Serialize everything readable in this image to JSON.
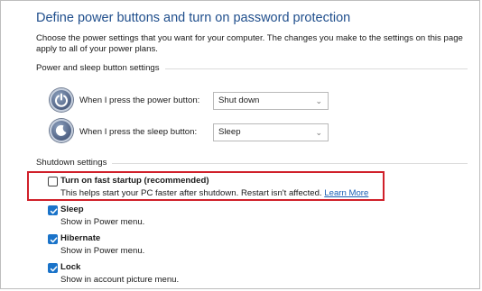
{
  "title": "Define power buttons and turn on password protection",
  "description": "Choose the power settings that you want for your computer. The changes you make to the settings on this page apply to all of your power plans.",
  "power_sleep_group": {
    "label": "Power and sleep button settings",
    "power_button": {
      "label": "When I press the power button:",
      "value": "Shut down",
      "icon": "power-button-icon"
    },
    "sleep_button": {
      "label": "When I press the sleep button:",
      "value": "Sleep",
      "icon": "sleep-button-icon"
    }
  },
  "shutdown_group": {
    "label": "Shutdown settings",
    "fast_startup": {
      "label": "Turn on fast startup (recommended)",
      "description": "This helps start your PC faster after shutdown. Restart isn't affected.",
      "link": "Learn More",
      "checked": false
    },
    "sleep": {
      "label": "Sleep",
      "description": "Show in Power menu.",
      "checked": true
    },
    "hibernate": {
      "label": "Hibernate",
      "description": "Show in Power menu.",
      "checked": true
    },
    "lock": {
      "label": "Lock",
      "description": "Show in account picture menu.",
      "checked": true
    }
  },
  "colors": {
    "title": "#1f4e8c",
    "highlight": "#d0202a",
    "checkbox": "#1a73c9",
    "link": "#1a5fb4"
  }
}
